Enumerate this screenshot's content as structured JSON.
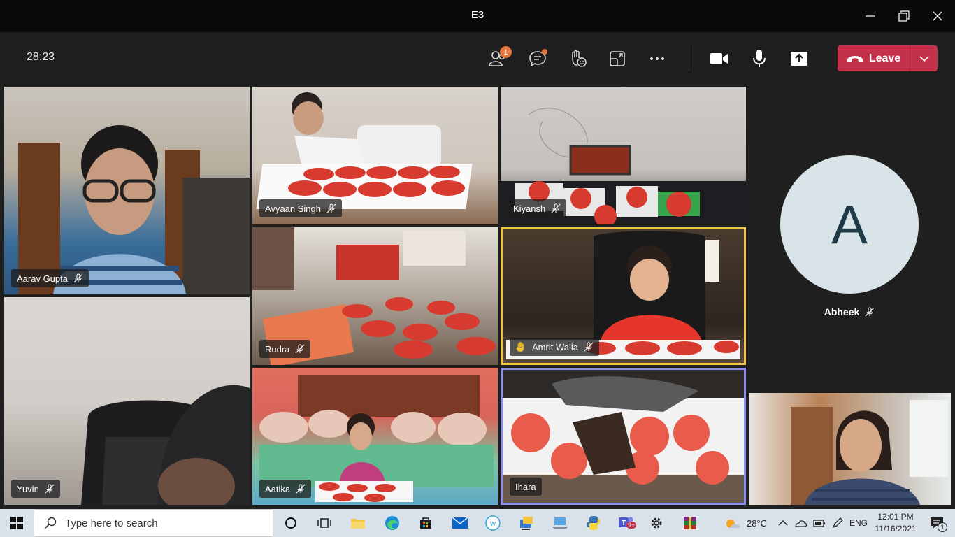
{
  "window": {
    "title": "E3"
  },
  "meeting": {
    "timer": "28:23",
    "participants_badge": "1",
    "leave_label": "Leave"
  },
  "tiles": [
    {
      "name": "Aarav Gupta"
    },
    {
      "name": "Avyaan Singh"
    },
    {
      "name": "Kiyansh"
    },
    {
      "name": "Rudra"
    },
    {
      "name": "Amrit Walia"
    },
    {
      "name": "Yuvin"
    },
    {
      "name": "Aatika"
    },
    {
      "name": "Ihara"
    }
  ],
  "avatar_tile": {
    "initial": "A",
    "name": "Abheek"
  },
  "taskbar": {
    "search_placeholder": "Type here to search",
    "weather": "28°C",
    "language": "ENG",
    "time": "12:01 PM",
    "date": "11/16/2021",
    "teams_badge": "9+",
    "notification_count": "1"
  },
  "colors": {
    "leave": "#c4314b",
    "active_speaker": "#f0c33c",
    "pinned": "#8d8df0",
    "badge": "#e3743a"
  }
}
